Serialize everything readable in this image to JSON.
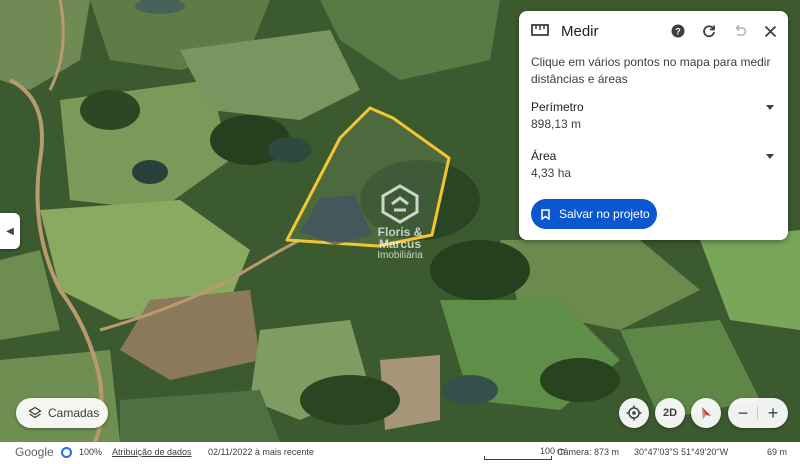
{
  "panel": {
    "title": "Medir",
    "description": "Clique em vários pontos no mapa para medir distâncias e áreas",
    "perimeter_label": "Perímetro",
    "perimeter_value": "898,13 m",
    "area_label": "Área",
    "area_value": "4,33 ha",
    "save_label": "Salvar no projeto",
    "icons": [
      "ruler-icon",
      "help-icon",
      "refresh-icon",
      "undo-icon",
      "close-icon"
    ]
  },
  "watermark": {
    "line1": "Floris &",
    "line2": "Marcus",
    "line3": "Imobiliária"
  },
  "controls": {
    "layers_label": "Camadas",
    "view_mode": "2D"
  },
  "statusbar": {
    "brand": "Google",
    "zoom": "100%",
    "attribution": "Atribuição de dados",
    "date": "02/11/2022 à mais recente",
    "scale": "100 m",
    "camera": "Câmera: 873 m",
    "coordinates": "30°47'03\"S 51°49'20\"W",
    "altitude": "69 m"
  },
  "colors": {
    "accent": "#0b57d0",
    "measure_outline": "#f2c531"
  }
}
